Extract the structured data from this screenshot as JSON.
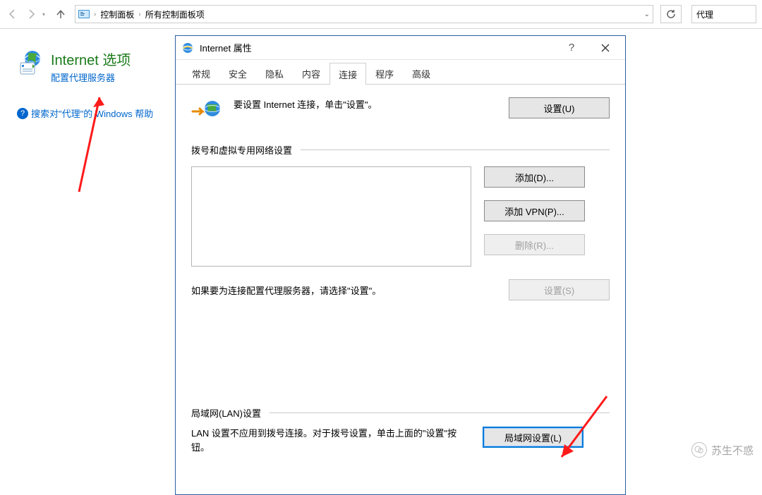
{
  "topbar": {
    "crumb1": "控制面板",
    "crumb2": "所有控制面板项",
    "search": "代理"
  },
  "explorer": {
    "option_title": "Internet 选项",
    "option_sub": "配置代理服务器",
    "help_text": "搜索对\"代理\"的 Windows 帮助"
  },
  "dialog": {
    "title": "Internet 属性",
    "tabs": {
      "t0": "常规",
      "t1": "安全",
      "t2": "隐私",
      "t3": "内容",
      "t4": "连接",
      "t5": "程序",
      "t6": "高级"
    },
    "conn_text": "要设置 Internet 连接，单击\"设置\"。",
    "btn_setup": "设置(U)",
    "dial_header": "拨号和虚拟专用网络设置",
    "btn_add": "添加(D)...",
    "btn_add_vpn": "添加 VPN(P)...",
    "btn_remove": "删除(R)...",
    "btn_settings": "设置(S)",
    "config_note": "如果要为连接配置代理服务器，请选择\"设置\"。",
    "lan_header": "局域网(LAN)设置",
    "lan_desc": "LAN 设置不应用到拨号连接。对于拨号设置，单击上面的\"设置\"按钮。",
    "btn_lan": "局域网设置(L)"
  },
  "watermark": "苏生不惑"
}
